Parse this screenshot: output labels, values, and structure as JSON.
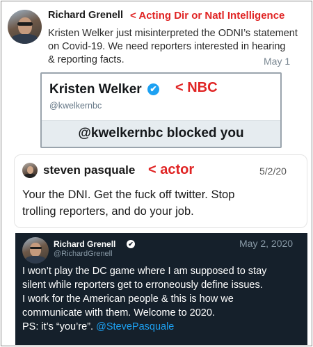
{
  "grenell_tweet": {
    "name": "Richard Grenell",
    "annotation": "< Acting Dir or Natl Intelligence",
    "lines": [
      "Kristen Welker just misinterpreted the ODNI’s statement",
      "on Covid-19.   We need reporters interested in hearing",
      "& reporting facts."
    ],
    "date": "May 1"
  },
  "blocked_card": {
    "name": "Kristen Welker",
    "annotation": "< NBC",
    "handle": "@kwelkernbc",
    "blocked_message": "@kwelkernbc blocked you",
    "verified_icon": "✔"
  },
  "pasquale_tweet": {
    "name": "steven pasquale",
    "annotation": "< actor",
    "date": "5/2/20",
    "lines": [
      "Your the DNI. Get the fuck off twitter. Stop",
      "trolling reporters, and do your job."
    ]
  },
  "grenell_reply": {
    "name": "Richard Grenell",
    "handle": "@RichardGrenell",
    "date": "May 2, 2020",
    "verified_icon": "✔",
    "lines": [
      "I won’t play the DC game where I am supposed to stay",
      "silent while reporters get to erroneously define issues.",
      "I work for the American people & this is how we",
      "communicate with them. Welcome to 2020."
    ],
    "ps_text": "PS: it’s “you’re”.",
    "mention": "@StevePasquale"
  },
  "colors": {
    "annotation_red": "#e02424",
    "twitter_blue": "#1da1f2",
    "dark_bg": "#15202b"
  }
}
